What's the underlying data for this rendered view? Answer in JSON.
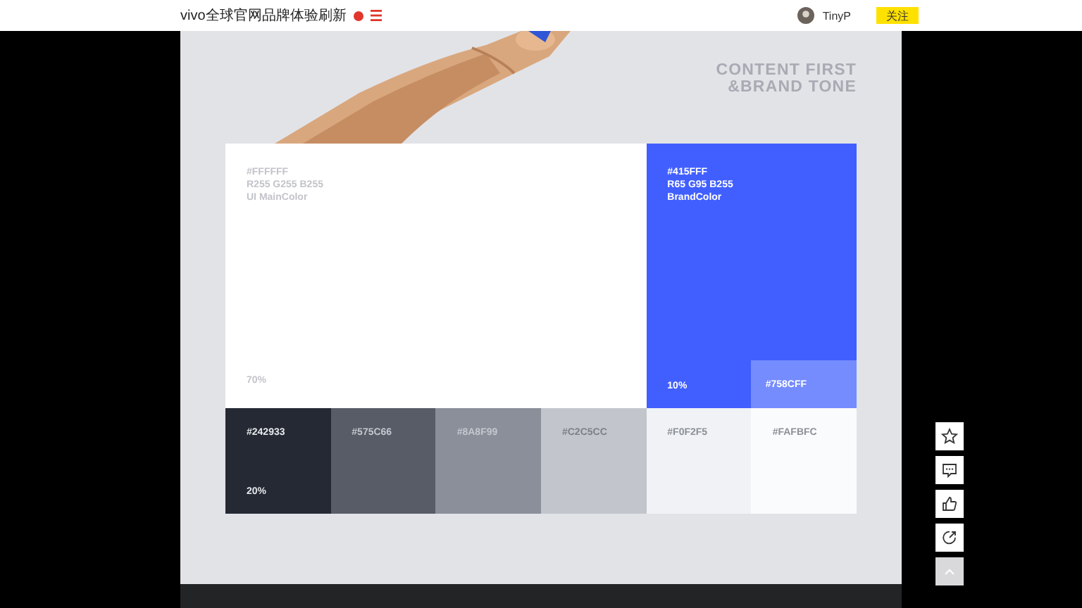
{
  "topbar": {
    "title": "vivo全球官网品牌体验刷新",
    "user": "TinyP",
    "follow_button": "关注"
  },
  "heading": [
    "CONTENT FIRST",
    "&BRAND TONE"
  ],
  "primary": {
    "hex": "#FFFFFF",
    "rgb": "R255 G255 B255",
    "role": "UI MainColor",
    "share": "70%",
    "color": "#ffffff"
  },
  "brand": {
    "hex": "#415FFF",
    "rgb": "R65 G95 B255",
    "role": "BrandColor",
    "share": "10%",
    "color": "#415fff"
  },
  "brand_tint": {
    "label": "#758CFF",
    "color": "#758cff"
  },
  "neutrals": [
    {
      "label": "#242933",
      "color": "#242933",
      "share": "20%"
    },
    {
      "label": "#575C66",
      "color": "#575c66"
    },
    {
      "label": "#8A8F99",
      "color": "#8a8f99"
    },
    {
      "label": "#C2C5CC",
      "color": "#c2c5cc"
    },
    {
      "label": "#F0F2F5",
      "color": "#f0f2f5"
    },
    {
      "label": "#FAFBFC",
      "color": "#fafbfc"
    }
  ],
  "side_actions": [
    {
      "kind": "star"
    },
    {
      "kind": "comment"
    },
    {
      "kind": "like"
    },
    {
      "kind": "share"
    },
    {
      "kind": "top"
    }
  ]
}
